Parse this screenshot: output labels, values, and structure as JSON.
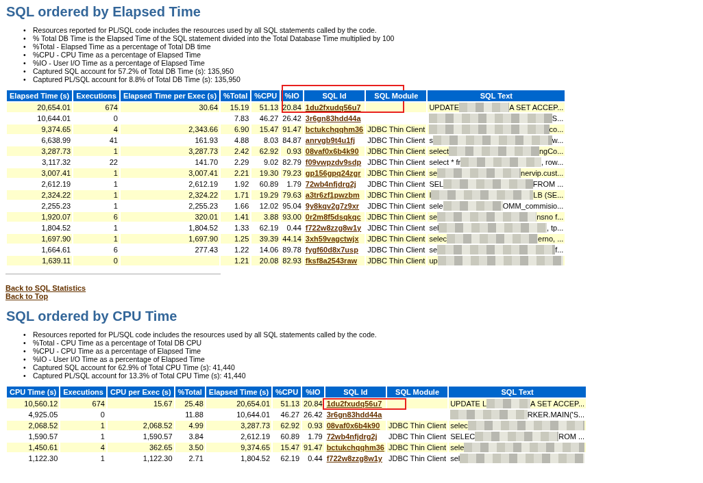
{
  "sections": [
    {
      "title": "SQL ordered by Elapsed Time",
      "bullet": "•",
      "notes": [
        "Resources reported for PL/SQL code includes the resources used by all SQL statements called by the code.",
        "% Total DB Time is the Elapsed Time of the SQL statement divided into the Total Database Time multiplied by 100",
        "%Total - Elapsed Time as a percentage of Total DB time",
        "%CPU - CPU Time as a percentage of Elapsed Time",
        "%IO - User I/O Time as a percentage of Elapsed Time",
        "Captured SQL account for 57.2% of Total DB Time (s): 135,950",
        "Captured PL/SQL account for 8.8% of Total DB Time (s): 135,950"
      ],
      "table": {
        "columns": [
          {
            "label": "Elapsed Time (s)",
            "kind": "number"
          },
          {
            "label": "Executions",
            "kind": "number"
          },
          {
            "label": "Elapsed Time per Exec (s)",
            "kind": "number"
          },
          {
            "label": "%Total",
            "kind": "number"
          },
          {
            "label": "%CPU",
            "kind": "number"
          },
          {
            "label": "%IO",
            "kind": "number"
          },
          {
            "label": "SQL Id",
            "kind": "id",
            "boxed": true
          },
          {
            "label": "SQL Module",
            "kind": "module"
          },
          {
            "label": "SQL Text",
            "kind": "sqltext"
          }
        ],
        "rows": [
          [
            "20,654.01",
            "674",
            "30.64",
            "15.19",
            "51.13",
            "20.84",
            "1du2fxudq56u7",
            null,
            {
              "start": "UPDATE",
              "end": "A SET ACCEP..."
            }
          ],
          [
            "10,644.01",
            "0",
            null,
            "7.83",
            "46.27",
            "26.42",
            "3r6gn83hdd44a",
            null,
            {
              "end": "S..."
            }
          ],
          [
            "9,374.65",
            "4",
            "2,343.66",
            "6.90",
            "15.47",
            "91.47",
            "bctukchqqhm36",
            "JDBC Thin Client",
            {
              "end": "co..."
            }
          ],
          [
            "6,638.99",
            "41",
            "161.93",
            "4.88",
            "8.03",
            "84.87",
            "anrvgb9t4u1fj",
            "JDBC Thin Client",
            {
              "start": "s",
              "end": "w..."
            }
          ],
          [
            "3,287.73",
            "1",
            "3,287.73",
            "2.42",
            "62.92",
            "0.93",
            "08vaf0x6b4k90",
            "JDBC Thin Client",
            {
              "start": "select",
              "end": "ngCo..."
            }
          ],
          [
            "3,117.32",
            "22",
            "141.70",
            "2.29",
            "9.02",
            "82.79",
            "f09vwpzdv9sdp",
            "JDBC Thin Client",
            {
              "start": "select * fr",
              "end": ", row..."
            }
          ],
          [
            "3,007.41",
            "1",
            "3,007.41",
            "2.21",
            "19.30",
            "79.23",
            "gp156gpq24zgr",
            "JDBC Thin Client",
            {
              "start": "se",
              "end": "nervip.cust..."
            }
          ],
          [
            "2,612.19",
            "1",
            "2,612.19",
            "1.92",
            "60.89",
            "1.79",
            "72wb4nfjdrg2j",
            "JDBC Thin Client",
            {
              "start": "SEL",
              "end": "FROM ..."
            }
          ],
          [
            "2,324.22",
            "1",
            "2,324.22",
            "1.71",
            "19.29",
            "79.63",
            "a3tr6zf1pwzbm",
            "JDBC Thin Client",
            {
              "start": "I",
              "end": "LB (SE..."
            }
          ],
          [
            "2,255.23",
            "1",
            "2,255.23",
            "1.66",
            "12.02",
            "95.04",
            "9y8kqv2g7z9xr",
            "JDBC Thin Client",
            {
              "start": "sele",
              "end": "OMM_commisio..."
            }
          ],
          [
            "1,920.07",
            "6",
            "320.01",
            "1.41",
            "3.88",
            "93.00",
            "0r2m8f5dsqkqc",
            "JDBC Thin Client",
            {
              "start": "se",
              "end": "nsno f..."
            }
          ],
          [
            "1,804.52",
            "1",
            "1,804.52",
            "1.33",
            "62.19",
            "0.44",
            "f722w8zzg8w1y",
            "JDBC Thin Client",
            {
              "start": "sel",
              "end": ", tp..."
            }
          ],
          [
            "1,697.90",
            "1",
            "1,697.90",
            "1.25",
            "39.39",
            "44.14",
            "3xh59vagctwjx",
            "JDBC Thin Client",
            {
              "start": "selec",
              "end": "erno, ..."
            }
          ],
          [
            "1,664.61",
            "6",
            "277.43",
            "1.22",
            "14.06",
            "89.78",
            "fygf60d8x7usp",
            "JDBC Thin Client",
            {
              "start": "se",
              "end": "f..."
            }
          ],
          [
            "1,639.11",
            "0",
            null,
            "1.21",
            "20.08",
            "82.93",
            "fksf8a2543raw",
            "JDBC Thin Client",
            {
              "start": "up"
            }
          ]
        ]
      },
      "links": [
        "Back to SQL Statistics",
        "Back to Top"
      ]
    },
    {
      "title": "SQL ordered by CPU Time",
      "bullet": "•",
      "notes": [
        "Resources reported for PL/SQL code includes the resources used by all SQL statements called by the code.",
        "%Total - CPU Time as a percentage of Total DB CPU",
        "%CPU - CPU Time as a percentage of Elapsed Time",
        "%IO - User I/O Time as a percentage of Elapsed Time",
        "Captured SQL account for 62.9% of Total CPU Time (s): 41,440",
        "Captured PL/SQL account for 13.3% of Total CPU Time (s): 41,440"
      ],
      "table": {
        "columns": [
          {
            "label": "CPU Time (s)",
            "kind": "number"
          },
          {
            "label": "Executions",
            "kind": "number"
          },
          {
            "label": "CPU per Exec (s)",
            "kind": "number"
          },
          {
            "label": "%Total",
            "kind": "number"
          },
          {
            "label": "Elapsed Time (s)",
            "kind": "number"
          },
          {
            "label": "%CPU",
            "kind": "number"
          },
          {
            "label": "%IO",
            "kind": "number"
          },
          {
            "label": "SQL Id",
            "kind": "id",
            "boxed": true
          },
          {
            "label": "SQL Module",
            "kind": "module"
          },
          {
            "label": "SQL Text",
            "kind": "sqltext"
          }
        ],
        "rows": [
          [
            "10,560.12",
            "674",
            "15.67",
            "25.48",
            "20,654.01",
            "51.13",
            "20.84",
            "1du2fxudq56u7",
            null,
            {
              "start": "UPDATE L",
              "end": "A SET ACCEP..."
            }
          ],
          [
            "4,925.05",
            "0",
            null,
            "11.88",
            "10,644.01",
            "46.27",
            "26.42",
            "3r6gn83hdd44a",
            null,
            {
              "end": "RKER.MAIN('S..."
            }
          ],
          [
            "2,068.52",
            "1",
            "2,068.52",
            "4.99",
            "3,287.73",
            "62.92",
            "0.93",
            "08vaf0x6b4k90",
            "JDBC Thin Client",
            {
              "start": "selec"
            }
          ],
          [
            "1,590.57",
            "1",
            "1,590.57",
            "3.84",
            "2,612.19",
            "60.89",
            "1.79",
            "72wb4nfjdrg2j",
            "JDBC Thin Client",
            {
              "start": "SELEC",
              "end": "ROM ..."
            }
          ],
          [
            "1,450.61",
            "4",
            "362.65",
            "3.50",
            "9,374.65",
            "15.47",
            "91.47",
            "bctukchqqhm36",
            "JDBC Thin Client",
            {
              "start": "sele"
            }
          ],
          [
            "1,122.30",
            "1",
            "1,122.30",
            "2.71",
            "1,804.52",
            "62.19",
            "0.44",
            "f722w8zzg8w1y",
            "JDBC Thin Client",
            {
              "start": "sel"
            }
          ]
        ]
      }
    }
  ]
}
